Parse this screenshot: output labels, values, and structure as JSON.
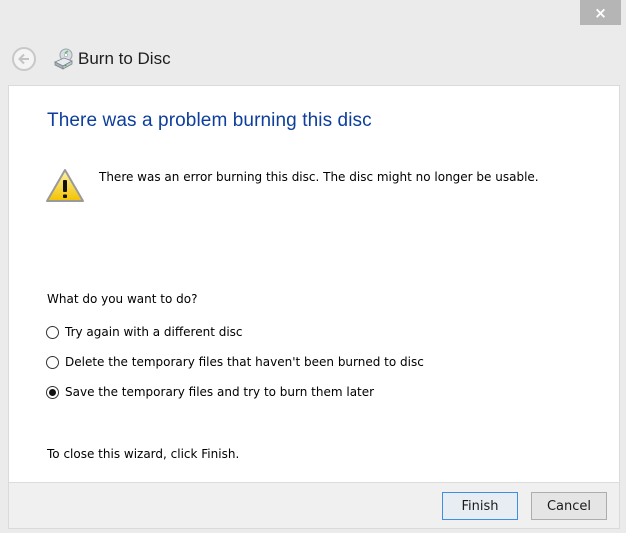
{
  "window": {
    "close_label": "×"
  },
  "nav": {
    "title": "Burn to Disc",
    "back_icon": "back-arrow-icon",
    "app_icon": "burn-disc-drive-icon"
  },
  "content": {
    "heading": "There was a problem burning this disc",
    "warning_icon": "warning-triangle-icon",
    "warning_message": "There was an error burning this disc. The disc might no longer be usable.",
    "question": "What do you want to do?",
    "options": [
      {
        "label": "Try again with a different disc",
        "selected": false
      },
      {
        "label": "Delete the temporary files that haven't been burned to disc",
        "selected": false
      },
      {
        "label": "Save the temporary files and try to burn them later",
        "selected": true
      }
    ],
    "close_hint": "To close this wizard, click Finish."
  },
  "footer": {
    "finish_label": "Finish",
    "cancel_label": "Cancel"
  },
  "colors": {
    "heading": "#0e3e9c",
    "default_button_border": "#3c8fe3",
    "close_button_bg": "#b5b5b5"
  }
}
